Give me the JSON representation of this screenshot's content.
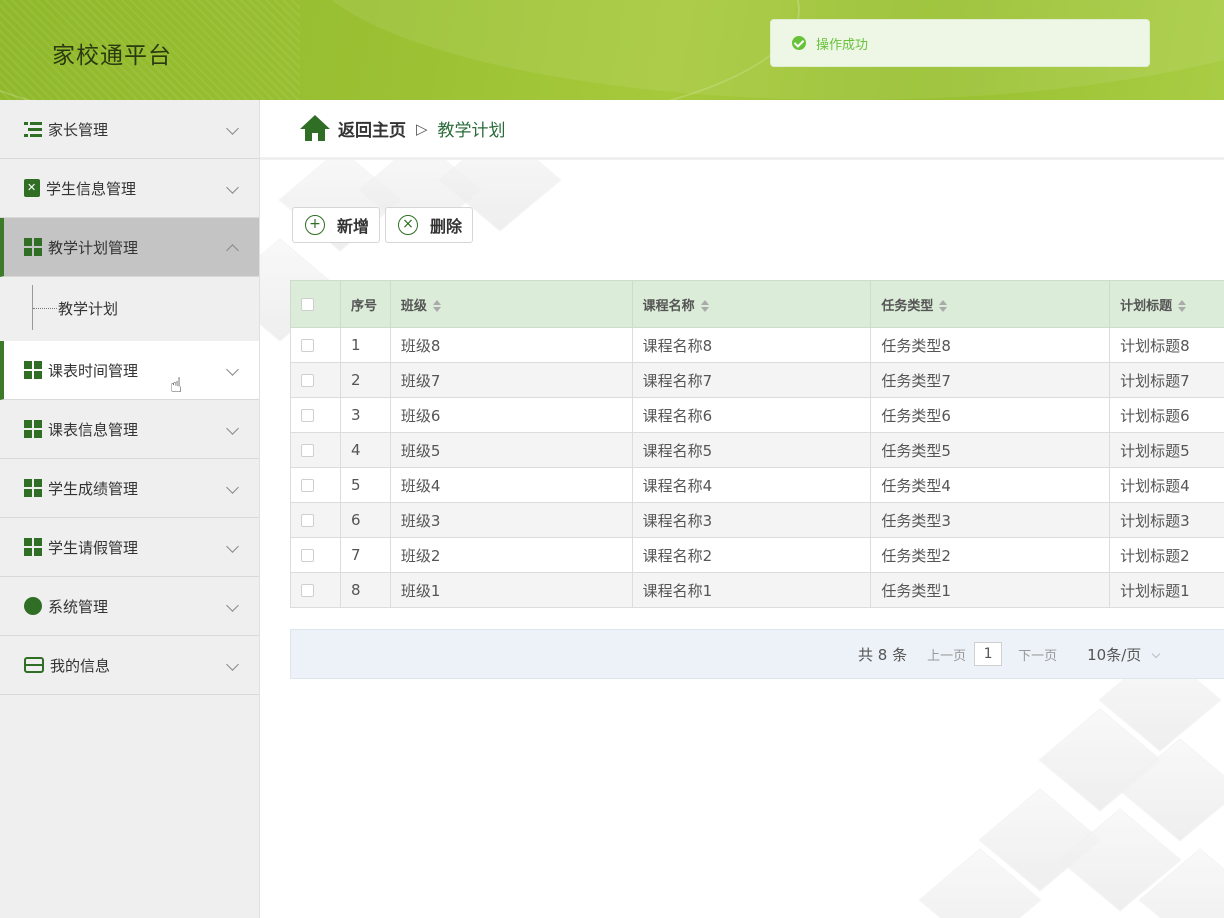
{
  "app": {
    "title": "家校通平台"
  },
  "toast": {
    "message": "操作成功",
    "icon": "success-check-icon",
    "color": "#67c23a"
  },
  "sidebar": {
    "items": [
      {
        "label": "家长管理",
        "icon": "list-icon"
      },
      {
        "label": "学生信息管理",
        "icon": "clipboard-icon"
      },
      {
        "label": "教学计划管理",
        "icon": "grid-icon",
        "expanded": true,
        "children": [
          {
            "label": "教学计划"
          }
        ]
      },
      {
        "label": "课表时间管理",
        "icon": "grid-icon"
      },
      {
        "label": "课表信息管理",
        "icon": "grid-icon"
      },
      {
        "label": "学生成绩管理",
        "icon": "grid-icon"
      },
      {
        "label": "学生请假管理",
        "icon": "grid-icon"
      },
      {
        "label": "系统管理",
        "icon": "bulb-icon"
      },
      {
        "label": "我的信息",
        "icon": "card-icon"
      }
    ]
  },
  "breadcrumb": {
    "home": "返回主页",
    "separator": "▷",
    "current": "教学计划"
  },
  "toolbar": {
    "add_label": "新增",
    "delete_label": "删除"
  },
  "table": {
    "columns": [
      "序号",
      "班级",
      "课程名称",
      "任务类型",
      "计划标题"
    ],
    "rows": [
      [
        "1",
        "班级8",
        "课程名称8",
        "任务类型8",
        "计划标题8"
      ],
      [
        "2",
        "班级7",
        "课程名称7",
        "任务类型7",
        "计划标题7"
      ],
      [
        "3",
        "班级6",
        "课程名称6",
        "任务类型6",
        "计划标题6"
      ],
      [
        "4",
        "班级5",
        "课程名称5",
        "任务类型5",
        "计划标题5"
      ],
      [
        "5",
        "班级4",
        "课程名称4",
        "任务类型4",
        "计划标题4"
      ],
      [
        "6",
        "班级3",
        "课程名称3",
        "任务类型3",
        "计划标题3"
      ],
      [
        "7",
        "班级2",
        "课程名称2",
        "任务类型2",
        "计划标题2"
      ],
      [
        "8",
        "班级1",
        "课程名称1",
        "任务类型1",
        "计划标题1"
      ]
    ]
  },
  "pager": {
    "total": "共 8 条",
    "prev": "上一页",
    "page": "1",
    "next": "下一页",
    "page_size": "10条/页"
  },
  "colors": {
    "accent": "#2f6e24",
    "header": "#9cc234",
    "table_header": "#dbecd8"
  }
}
